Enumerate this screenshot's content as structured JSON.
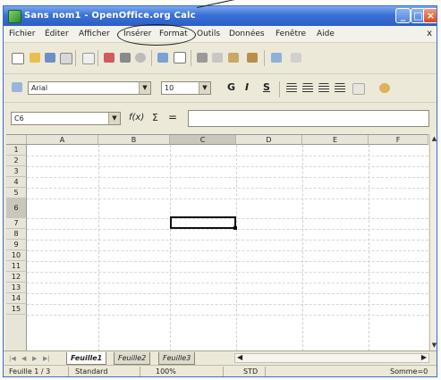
{
  "window": {
    "title": "Sans nom1 - OpenOffice.org Calc",
    "icon": "calc-app-icon",
    "controls": [
      "minimize",
      "maximize",
      "close"
    ]
  },
  "menubar": {
    "items": [
      "Fichier",
      "Éditer",
      "Afficher",
      "Insérer",
      "Format",
      "Outils",
      "Données",
      "Fenêtre",
      "Aide"
    ],
    "close_glyph": "x"
  },
  "toolbar_format": {
    "font_name": "Arial",
    "font_size": "10",
    "bold": "G",
    "italic": "I",
    "underline": "S"
  },
  "formula_bar": {
    "cell_ref": "C6",
    "fx": "f(x)",
    "sigma": "Σ",
    "equals": "=",
    "content": ""
  },
  "grid": {
    "columns": [
      "A",
      "B",
      "C",
      "D",
      "E",
      "F"
    ],
    "selected_column": "C",
    "rows": [
      "1",
      "2",
      "3",
      "4",
      "5",
      "6",
      "7",
      "8",
      "9",
      "10",
      "11",
      "12",
      "13",
      "14",
      "15"
    ],
    "selected_row": "6",
    "selected_cell": "C6"
  },
  "sheets": {
    "tabs": [
      "Feuille1",
      "Feuille2",
      "Feuille3"
    ],
    "active": "Feuille1"
  },
  "statusbar": {
    "sheet": "Feuille 1 / 3",
    "style": "Standard",
    "zoom": "100%",
    "mode": "STD",
    "sum": "Somme=0"
  },
  "colors": {
    "titlebar": "#2c5ec4",
    "chrome": "#ece9d8",
    "header": "#e7e4d8",
    "selected_header": "#c9c6bb"
  }
}
